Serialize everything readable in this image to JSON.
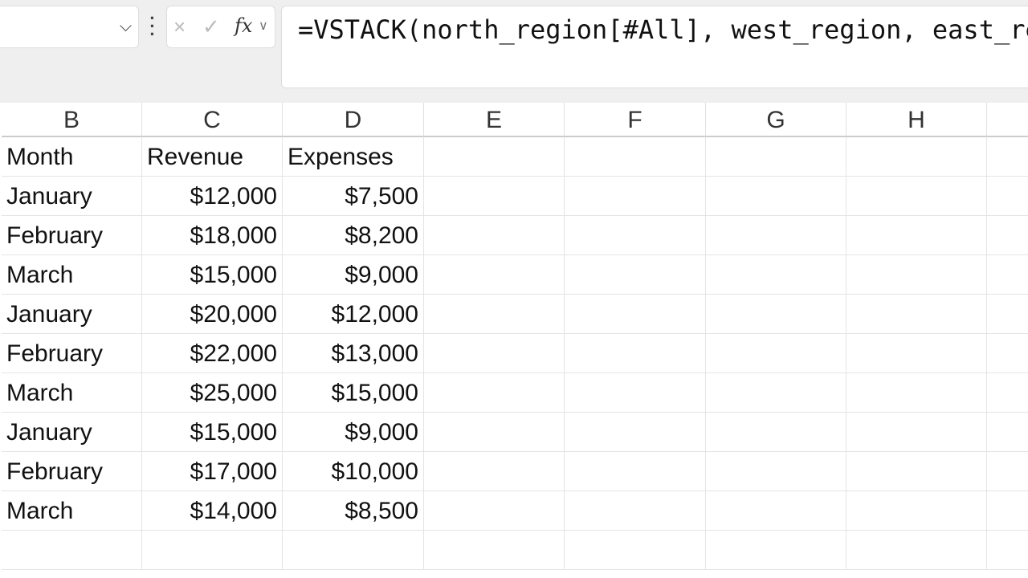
{
  "formula_bar": {
    "name_box": "",
    "formula": "=VSTACK(north_region[#All], west_region, east_region)",
    "cancel_icon": "×",
    "enter_icon": "✓",
    "fx_label": "fx"
  },
  "columns": [
    "B",
    "C",
    "D",
    "E",
    "F",
    "G",
    "H"
  ],
  "rows": [
    [
      "Month",
      "Revenue",
      "Expenses"
    ],
    [
      "January",
      "$12,000",
      "$7,500"
    ],
    [
      "February",
      "$18,000",
      "$8,200"
    ],
    [
      "March",
      "$15,000",
      "$9,000"
    ],
    [
      "January",
      "$20,000",
      "$12,000"
    ],
    [
      "February",
      "$22,000",
      "$13,000"
    ],
    [
      "March",
      "$25,000",
      "$15,000"
    ],
    [
      "January",
      "$15,000",
      "$9,000"
    ],
    [
      "February",
      "$17,000",
      "$10,000"
    ],
    [
      "March",
      "$14,000",
      "$8,500"
    ]
  ]
}
